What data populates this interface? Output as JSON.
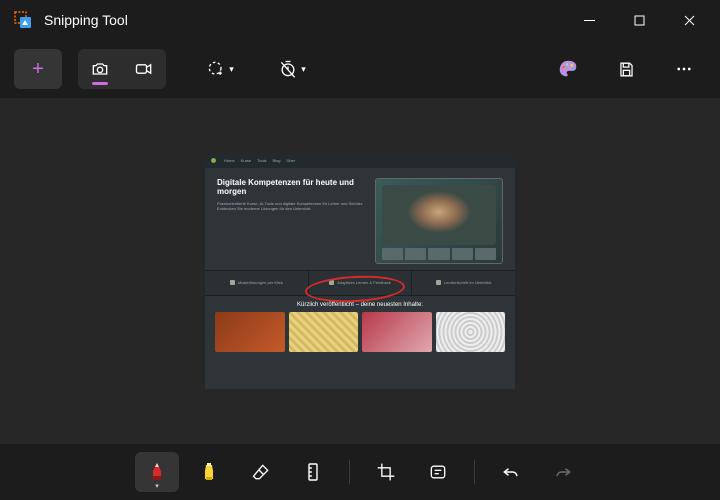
{
  "window": {
    "title": "Snipping Tool"
  },
  "toolbar": {
    "new_tooltip": "New",
    "photo_mode": "Photo",
    "video_mode": "Video",
    "shape_mode": "Rectangle",
    "delay": "No delay"
  },
  "screenshot_content": {
    "hero_title": "Digitale Kompetenzen für heute und morgen",
    "hero_sub": "Praxisorientierte Kurse, AI-Tools und digitale Kompetenzen für Lehrer und Schüler. Entdecken Sie moderne Lösungen für den Unterricht.",
    "strip_items": [
      "Musterlösungen per Klick",
      "Adaptives Lernen & Feedback",
      "Lernfortschritt im Überblick"
    ],
    "section_title": "Kürzlich veröffentlicht – deine neuesten Inhalte:"
  },
  "tools": {
    "pen": "Ballpoint pen",
    "highlighter": "Highlighter",
    "eraser": "Eraser",
    "ruler": "Ruler",
    "crop": "Crop",
    "text_actions": "Text actions",
    "undo": "Undo",
    "redo": "Redo"
  },
  "colors": {
    "accent": "#cc6ce7",
    "pen": "#d82a2a",
    "highlighter": "#ffd43b"
  }
}
